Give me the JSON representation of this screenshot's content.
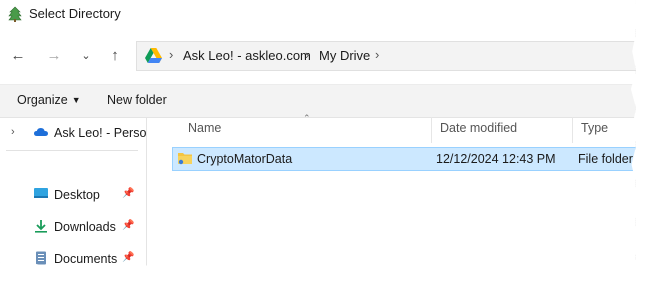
{
  "window": {
    "title": "Select Directory"
  },
  "address": {
    "crumbs": [
      "Ask Leo! - askleo.com",
      "My Drive"
    ]
  },
  "commands": {
    "organize": "Organize",
    "new_folder": "New folder"
  },
  "nav_pane": {
    "cloud_item": "Ask Leo! - Perso",
    "quick_access": [
      {
        "label": "Desktop",
        "icon": "desktop-icon"
      },
      {
        "label": "Downloads",
        "icon": "download-icon"
      },
      {
        "label": "Documents",
        "icon": "document-icon"
      }
    ]
  },
  "columns": {
    "name": "Name",
    "date_modified": "Date modified",
    "type": "Type"
  },
  "files": [
    {
      "name": "CryptoMatorData",
      "date_modified": "12/12/2024 12:43 PM",
      "type": "File folder",
      "selected": true
    }
  ],
  "colors": {
    "selection_bg": "#cce8ff",
    "selection_border": "#99d1ff",
    "folder": "#f4c542",
    "cloud": "#1e6fd9"
  }
}
